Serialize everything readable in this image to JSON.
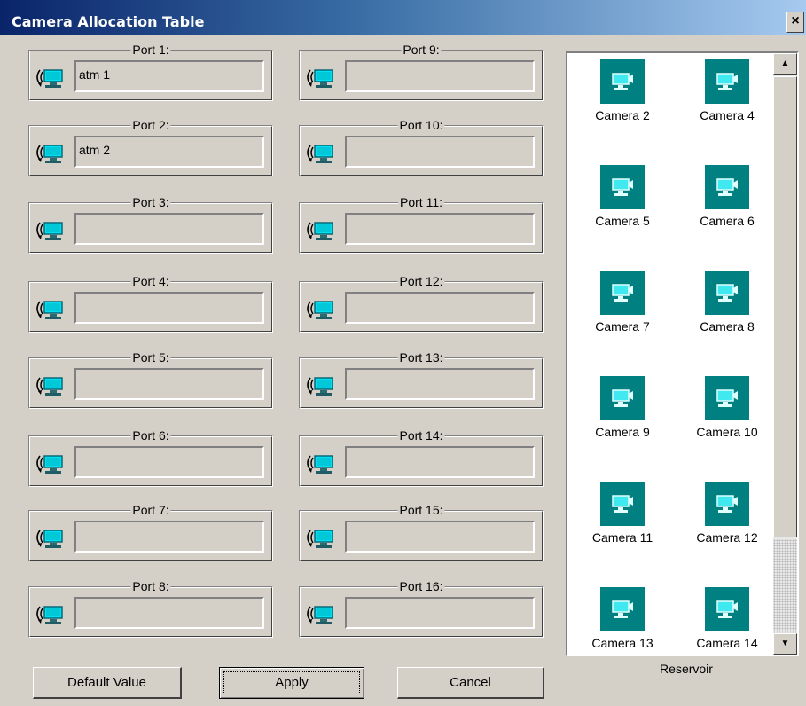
{
  "window": {
    "title": "Camera Allocation Table",
    "close_label": "×"
  },
  "ports": [
    {
      "label": "Port 1:",
      "value": "atm 1"
    },
    {
      "label": "Port 2:",
      "value": "atm 2"
    },
    {
      "label": "Port 3:",
      "value": ""
    },
    {
      "label": "Port 4:",
      "value": ""
    },
    {
      "label": "Port 5:",
      "value": ""
    },
    {
      "label": "Port 6:",
      "value": ""
    },
    {
      "label": "Port 7:",
      "value": ""
    },
    {
      "label": "Port 8:",
      "value": ""
    },
    {
      "label": "Port 9:",
      "value": ""
    },
    {
      "label": "Port 10:",
      "value": ""
    },
    {
      "label": "Port 11:",
      "value": ""
    },
    {
      "label": "Port 12:",
      "value": ""
    },
    {
      "label": "Port 13:",
      "value": ""
    },
    {
      "label": "Port 14:",
      "value": ""
    },
    {
      "label": "Port 15:",
      "value": ""
    },
    {
      "label": "Port 16:",
      "value": ""
    }
  ],
  "reservoir": {
    "label": "Reservoir",
    "cameras": [
      "Camera 2",
      "Camera 4",
      "Camera 5",
      "Camera 6",
      "Camera 7",
      "Camera 8",
      "Camera 9",
      "Camera 10",
      "Camera 11",
      "Camera 12",
      "Camera 13",
      "Camera 14"
    ],
    "icon": "camera-monitor-icon",
    "tile_color": "#008080",
    "scroll_up": "▲",
    "scroll_down": "▼"
  },
  "buttons": {
    "default_value": "Default Value",
    "apply": "Apply",
    "cancel": "Cancel"
  },
  "colors": {
    "titlebar_start": "#0a246a",
    "titlebar_end": "#a6caf0",
    "dialog_bg": "#d4d0c8"
  }
}
